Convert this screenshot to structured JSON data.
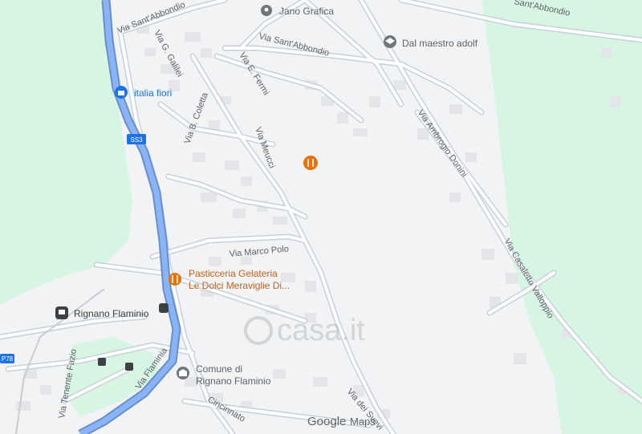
{
  "map": {
    "streets": {
      "sant_abbondio_1": "Via Sant'Abbondio",
      "sant_abbondio_2": "Via Sant'Abbondio",
      "sant_abbondio_3": "Sant'Abbondio",
      "galilei": "Via G. Galilei",
      "fermi": "Via E. Fermi",
      "coletta": "Via B. Coletta",
      "meucci": "Via Meucci",
      "marco_polo": "Via Marco Polo",
      "ambrogio_donini": "Via Ambrogio Donini",
      "casaletto": "Via Casaletto Valloppio",
      "flaminia": "Via Flaminia",
      "tenente_fazio": "Via Tenente Fazio",
      "cincinnato": "Cincinnato",
      "dei_svevi": "Via dei Svevi",
      "ss3": "SS3",
      "p78": "P78"
    },
    "pois": {
      "jano_grafica": "Jano Grafica",
      "dal_maestro": "Dal maestro adolf",
      "italia_fiori": "italia fiori",
      "pasticceria_line1": "Pasticceria Gelateria",
      "pasticceria_line2": "Le Dolci Meraviglie Di...",
      "rignano_flaminio": "Rignano Flaminio",
      "comune_line1": "Comune di",
      "comune_line2": "Rignano Flaminio"
    },
    "attribution": {
      "google": "Google",
      "maps": "Maps"
    },
    "watermark": "casa.it",
    "colors": {
      "background": "#f1f3f4",
      "green_area": "#d6f5e3",
      "highway": "#8ab4f8",
      "road": "#ffffff",
      "building": "#e8eaed",
      "poi_orange": "#e8710a",
      "poi_blue": "#1a73e8",
      "poi_gray": "#70757a"
    }
  }
}
